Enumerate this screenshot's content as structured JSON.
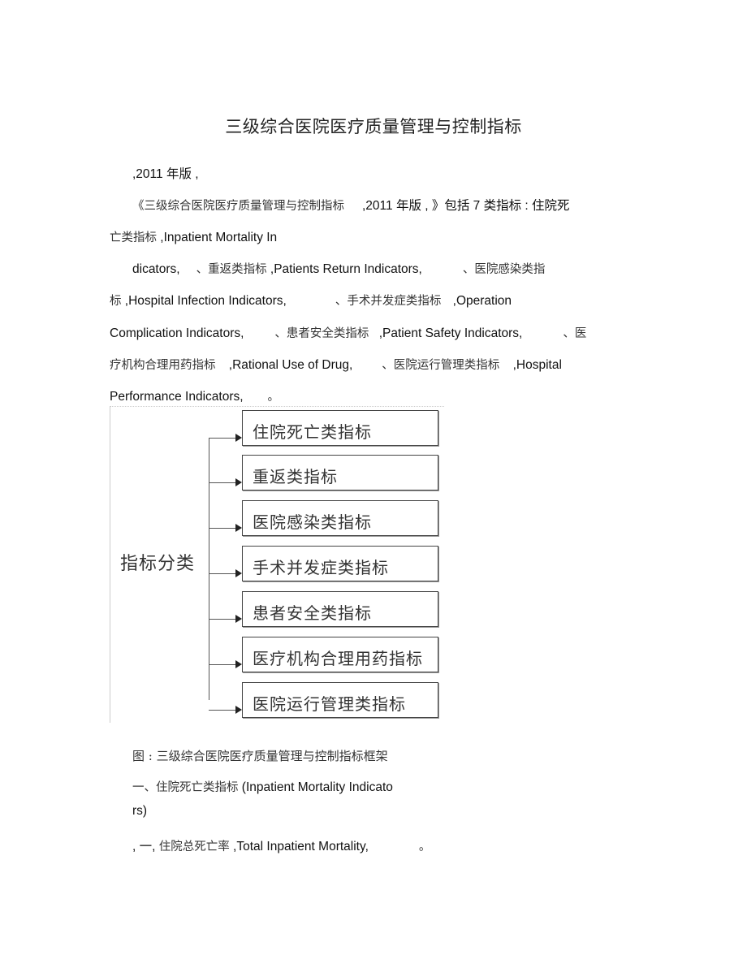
{
  "document": {
    "title": "三级综合医院医疗质量管理与控制指标",
    "edition_line": ",2011 年版 ,",
    "intro": {
      "line1": {
        "cn1": "《三级综合医院医疗质量管理与控制指标",
        "en1": ",2011 年版 , 》包括 7 类指标 : 住院死"
      },
      "line2": {
        "cn": "亡类指标",
        "en": " ,Inpatient Mortality In"
      },
      "line3": {
        "en1": "dicators,",
        "cn1": "、重返类指标",
        "en2": " ,Patients Return Indicators,",
        "cn2": "、医院感染类指"
      },
      "line4": {
        "cn1": "标",
        "en1": " ,Hospital Infection Indicators,",
        "cn2": "、手术并发症类指标",
        "en2": " ,Operation"
      },
      "line5": {
        "en1": "Complication Indicators,",
        "cn1": "、患者安全类指标",
        "en2": " ,Patient Safety Indicators,",
        "cn2": "、医"
      },
      "line6": {
        "cn1": "疗机构合理用药指标",
        "en1": " ,Rational Use of Drug,",
        "cn2": "、医院运行管理类指标",
        "en2": " ,Hospital"
      },
      "line7": {
        "en1": "Performance Indicators,",
        "cn1": "。"
      }
    },
    "diagram": {
      "root": "指标分类",
      "nodes": [
        "住院死亡类指标",
        "重返类指标",
        "医院感染类指标",
        "手术并发症类指标",
        "患者安全类指标",
        "医疗机构合理用药指标",
        "医院运行管理类指标"
      ]
    },
    "caption": "图 : 三级综合医院医疗质量管理与控制指标框架",
    "section1": {
      "heading_cn": "一、住院死亡类指标",
      "heading_en1": " (Inpatient Mortality Indicato",
      "heading_en2": "rs)"
    },
    "item1": {
      "prefix": ", 一, ",
      "cn": "住院总死亡率",
      "en": " ,Total Inpatient Mortality,",
      "end": "。"
    }
  }
}
